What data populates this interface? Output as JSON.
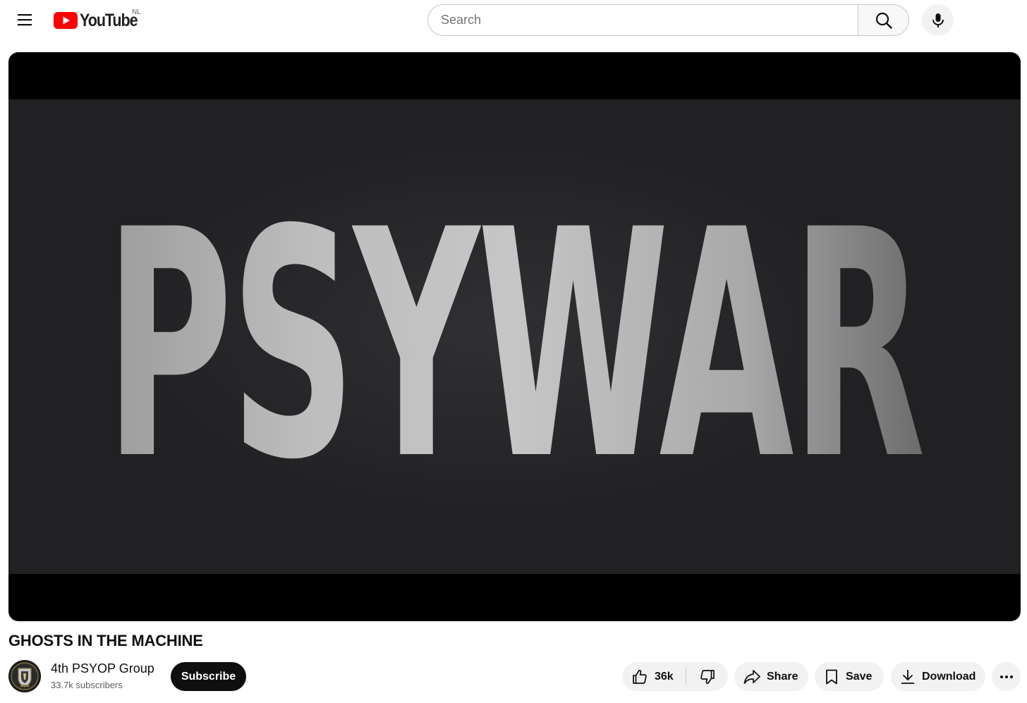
{
  "header": {
    "logo_text": "YouTube",
    "region_code": "NL",
    "search_placeholder": "Search",
    "search_value": "",
    "brand_red": "#ff0000",
    "icons": [
      "menu-icon",
      "youtube-logo-icon",
      "search-icon",
      "microphone-icon"
    ]
  },
  "player": {
    "frame_text": "PSYWAR",
    "frame_background": "#212124",
    "letterbox_color": "#000000"
  },
  "video": {
    "title": "GHOSTS IN THE MACHINE"
  },
  "channel": {
    "name": "4th PSYOP Group",
    "subscribers": "33.7k subscribers",
    "subscribe_label": "Subscribe"
  },
  "actions": {
    "like_count": "36k",
    "share_label": "Share",
    "save_label": "Save",
    "download_label": "Download",
    "icons": [
      "thumbs-up-icon",
      "thumbs-down-icon",
      "share-icon",
      "bookmark-icon",
      "download-icon",
      "more-icon"
    ]
  }
}
